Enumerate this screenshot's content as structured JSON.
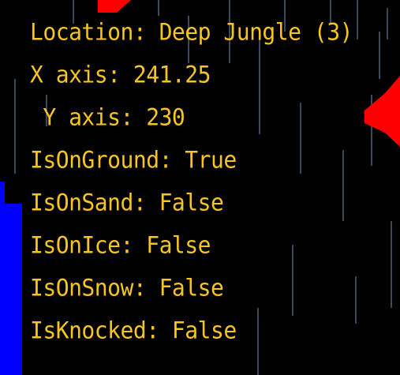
{
  "hud": {
    "location": "Location: Deep Jungle (3)",
    "x_axis": "X axis: 241.25",
    "y_axis": " Y axis: 230",
    "on_ground": "IsOnGround: True",
    "on_sand": "IsOnSand: False",
    "on_ice": "IsOnIce: False",
    "on_snow": "IsOnSnow: False",
    "knocked": "IsKnocked: False"
  },
  "colors": {
    "background": "#000000",
    "hud_text": "#f6c61e",
    "rain": "#3a4a5a",
    "red_object": "#ff0000",
    "blue_object": "#0000ff"
  }
}
